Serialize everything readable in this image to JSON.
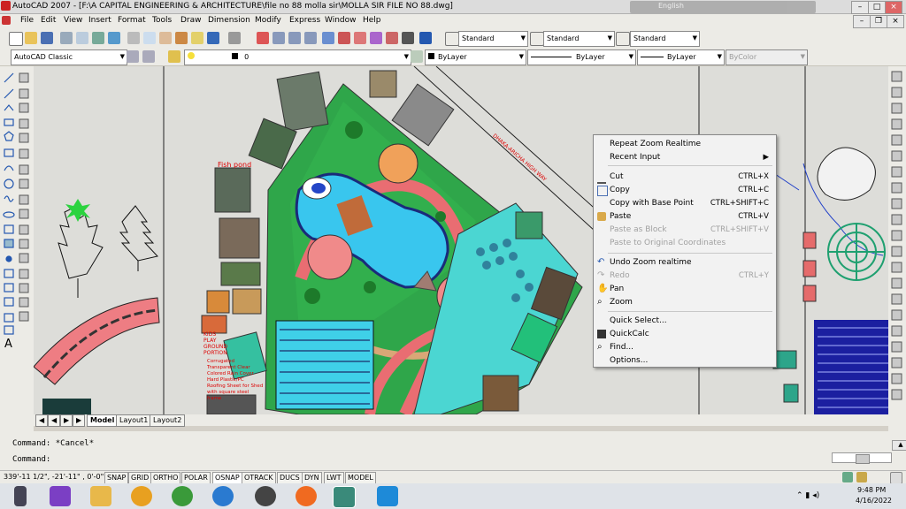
{
  "window": {
    "title": "AutoCAD 2007 - [F:\\A CAPITAL ENGINEERING & ARCHITECTURE\\file no 88 molla sir\\MOLLA SIR FILE NO 88.dwg]",
    "language": "English"
  },
  "menu": [
    "File",
    "Edit",
    "View",
    "Insert",
    "Format",
    "Tools",
    "Draw",
    "Dimension",
    "Modify",
    "Express",
    "Window",
    "Help"
  ],
  "toolbar": {
    "text_style": "Standard",
    "dim_style": "Standard",
    "table_style": "Standard",
    "workspace": "AutoCAD Classic",
    "layer": "0",
    "color": "ByLayer",
    "linetype": "ByLayer",
    "lineweight": "ByLayer",
    "plotstyle": "ByColor"
  },
  "layout_tabs": [
    "Model",
    "Layout1",
    "Layout2"
  ],
  "command": {
    "line1": "Command: *Cancel*",
    "line2": "Command:"
  },
  "status": {
    "coords": "339'-11 1/2\", -21'-11\" , 0'-0\"",
    "toggles": [
      "SNAP",
      "GRID",
      "ORTHO",
      "POLAR",
      "OSNAP",
      "OTRACK",
      "DUCS",
      "DYN",
      "LWT",
      "MODEL"
    ]
  },
  "clock": {
    "time": "9:48 PM",
    "date": "4/16/2022"
  },
  "context_menu": {
    "items": [
      {
        "label": "Repeat Zoom Realtime",
        "shortcut": "",
        "disabled": false,
        "submenu": false
      },
      {
        "label": "Recent Input",
        "shortcut": "",
        "disabled": false,
        "submenu": true
      },
      {
        "label": "Cut",
        "shortcut": "CTRL+X",
        "disabled": false,
        "submenu": false
      },
      {
        "label": "Copy",
        "shortcut": "CTRL+C",
        "disabled": false,
        "submenu": false
      },
      {
        "label": "Copy with Base Point",
        "shortcut": "CTRL+SHIFT+C",
        "disabled": false,
        "submenu": false
      },
      {
        "label": "Paste",
        "shortcut": "CTRL+V",
        "disabled": false,
        "submenu": false
      },
      {
        "label": "Paste as Block",
        "shortcut": "CTRL+SHIFT+V",
        "disabled": true,
        "submenu": false
      },
      {
        "label": "Paste to Original Coordinates",
        "shortcut": "",
        "disabled": true,
        "submenu": false
      },
      {
        "label": "Undo Zoom realtime",
        "shortcut": "",
        "disabled": false,
        "submenu": false
      },
      {
        "label": "Redo",
        "shortcut": "CTRL+Y",
        "disabled": true,
        "submenu": false
      },
      {
        "label": "Pan",
        "shortcut": "",
        "disabled": false,
        "submenu": false
      },
      {
        "label": "Zoom",
        "shortcut": "",
        "disabled": false,
        "submenu": false
      },
      {
        "label": "Quick Select...",
        "shortcut": "",
        "disabled": false,
        "submenu": false
      },
      {
        "label": "QuickCalc",
        "shortcut": "",
        "disabled": false,
        "submenu": false
      },
      {
        "label": "Find...",
        "shortcut": "",
        "disabled": false,
        "submenu": false
      },
      {
        "label": "Options...",
        "shortcut": "",
        "disabled": false,
        "submenu": false
      }
    ]
  },
  "drawing_labels": {
    "fish_pond": "Fish pond",
    "kids_play": "KIDS PLAY GROUND PORTION",
    "roof_note": "Corrugated Transparent Clear Colored Rain Cover Hard Plastic/PC Roofing Sheet for Shed with square steel frame",
    "road": "DHAKA-ARICHA HIGH WAY"
  },
  "colors": {
    "grass": "#2fa64a",
    "water": "#39c6ee",
    "path": "#f07c7c",
    "annotation": "#dd0000",
    "accent": "#1e5fb4"
  }
}
